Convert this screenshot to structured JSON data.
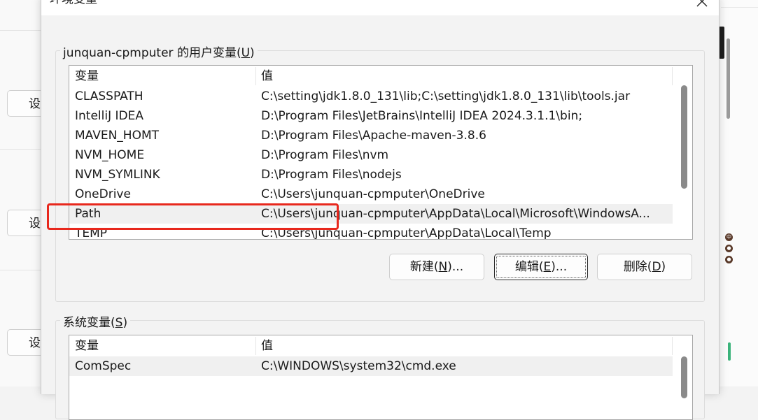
{
  "background": {
    "buttons": [
      "设",
      "设",
      "设"
    ],
    "dot_glyphs": [
      "中",
      "●",
      "●"
    ]
  },
  "dialog": {
    "title": "环境变量"
  },
  "user_vars": {
    "label_prefix": "junquan-cpmputer 的用户变量(",
    "label_accel": "U",
    "label_suffix": ")",
    "columns": [
      "变量",
      "值"
    ],
    "rows": [
      {
        "name": "CLASSPATH",
        "value": "C:\\setting\\jdk1.8.0_131\\lib;C:\\setting\\jdk1.8.0_131\\lib\\tools.jar"
      },
      {
        "name": "IntelliJ IDEA",
        "value": "D:\\Program Files\\JetBrains\\IntelliJ IDEA 2024.3.1.1\\bin;"
      },
      {
        "name": "MAVEN_HOMT",
        "value": "D:\\Program Files\\Apache-maven-3.8.6"
      },
      {
        "name": "NVM_HOME",
        "value": "D:\\Program Files\\nvm"
      },
      {
        "name": "NVM_SYMLINK",
        "value": "D:\\Program Files\\nodejs"
      },
      {
        "name": "OneDrive",
        "value": "C:\\Users\\junquan-cpmputer\\OneDrive"
      },
      {
        "name": "Path",
        "value": "C:\\Users\\junquan-cpmputer\\AppData\\Local\\Microsoft\\WindowsA..."
      },
      {
        "name": "TEMP",
        "value": "C:\\Users\\junquan-cpmputer\\AppData\\Local\\Temp"
      }
    ],
    "selected_row": "Path",
    "buttons": {
      "new": {
        "prefix": "新建(",
        "accel": "N",
        "suffix": ")..."
      },
      "edit": {
        "prefix": "编辑(",
        "accel": "E",
        "suffix": ")..."
      },
      "delete": {
        "prefix": "删除(",
        "accel": "D",
        "suffix": ")"
      }
    }
  },
  "system_vars": {
    "label_prefix": "系统变量(",
    "label_accel": "S",
    "label_suffix": ")",
    "columns": [
      "变量",
      "值"
    ],
    "rows": [
      {
        "name": "ComSpec",
        "value": "C:\\WINDOWS\\system32\\cmd.exe"
      }
    ]
  },
  "colors": {
    "highlight": "#e8281d",
    "selected_row": "#f0f0f0"
  }
}
